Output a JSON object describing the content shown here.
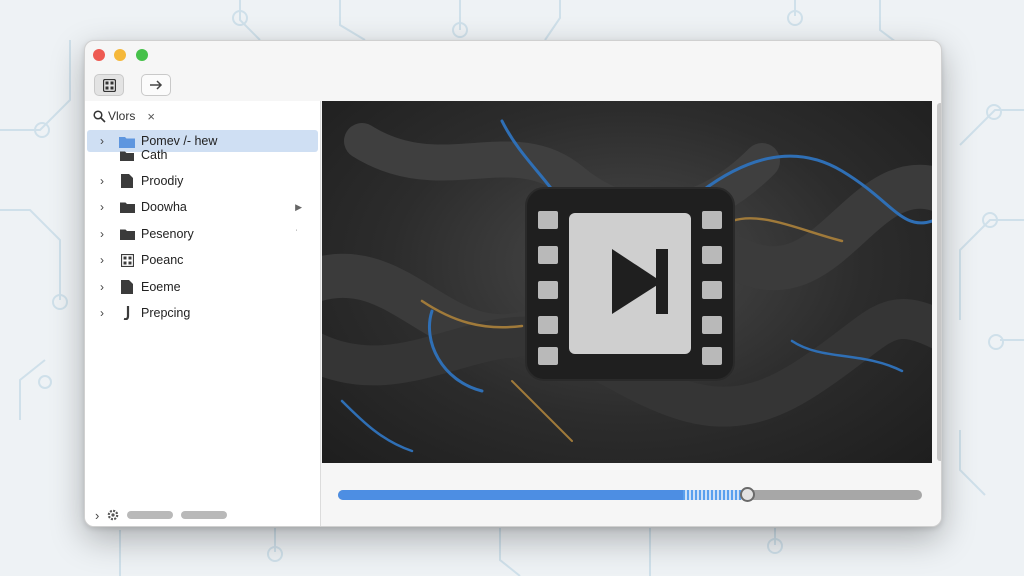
{
  "sidebar": {
    "search_label": "Vlors",
    "close_glyph": "×",
    "items": [
      {
        "label": "Pomev /- hew",
        "sublabel": "Cath",
        "icon": "folder-icon",
        "selected": true
      },
      {
        "label": "Proodiy",
        "icon": "document-icon"
      },
      {
        "label": "Doowha",
        "icon": "folder-icon"
      },
      {
        "label": "Pesenory",
        "icon": "folder-icon"
      },
      {
        "label": "Poeanc",
        "icon": "grid-icon"
      },
      {
        "label": "Eoeme",
        "icon": "document-icon"
      },
      {
        "label": "Prepcing",
        "icon": "script-icon"
      }
    ]
  },
  "player": {
    "progress": 0.59,
    "buffered": 0.7
  },
  "colors": {
    "accent": "#4d8ee3",
    "selection": "#cfdff3"
  }
}
